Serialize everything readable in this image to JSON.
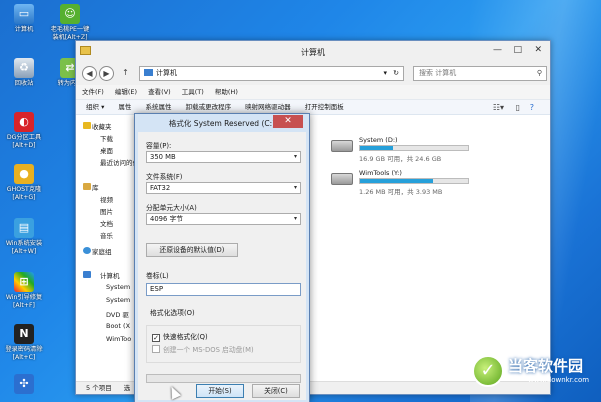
{
  "desktop": {
    "icons": [
      {
        "label": "计算机",
        "icon": "computer-icon"
      },
      {
        "label": "回收站",
        "icon": "recycle-bin-icon"
      },
      {
        "label": "DG分区工具\n[Alt+D]",
        "icon": "partition-tool-icon"
      },
      {
        "label": "GHOST克隆\n[Alt+G]",
        "icon": "ghost-icon"
      },
      {
        "label": "Win系统安装\n[Alt+W]",
        "icon": "win-install-icon"
      },
      {
        "label": "Win引导修复\n[Alt+F]",
        "icon": "boot-repair-icon"
      },
      {
        "label": "登录密码清除\n[Alt+C]",
        "icon": "password-clear-icon"
      },
      {
        "label": "老毛桃PE一键\n装机[Alt+Z]",
        "icon": "onekey-install-icon"
      },
      {
        "label": "转为内置",
        "icon": "convert-icon"
      }
    ],
    "watermark_text": "当客软件园",
    "watermark_url": "www.downkr.com"
  },
  "explorer": {
    "title": "计算机",
    "address": "计算机",
    "search_placeholder": "搜索 计算机",
    "menu": [
      "文件(F)",
      "编辑(E)",
      "查看(V)",
      "工具(T)",
      "帮助(H)"
    ],
    "toolbar": [
      "组织 ▾",
      "属性",
      "系统属性",
      "卸载或更改程序",
      "映射网络驱动器",
      "打开控制面板"
    ],
    "nav": {
      "favorites": "收藏夹",
      "fav_items": [
        "下载",
        "桌面",
        "最近访问的位置"
      ],
      "libraries": "库",
      "lib_items": [
        "视频",
        "图片",
        "文档",
        "音乐"
      ],
      "homegroup": "家庭组",
      "computer": "计算机",
      "computer_items": [
        "System",
        "System",
        "DVD 驱",
        "Boot (X",
        "WimToo"
      ]
    },
    "drives": [
      {
        "name": "System (D:)",
        "free_text": "16.9 GB 可用，共 24.6 GB",
        "used_fraction": 0.31
      },
      {
        "name": "WimTools (Y:)",
        "free_text": "1.26 MB 可用，共 3.93 MB",
        "used_fraction": 0.68
      }
    ],
    "status_left": "5 个项目",
    "status_right": "选"
  },
  "dialog": {
    "title": "格式化 System Reserved (C:)",
    "capacity_label": "容量(P):",
    "capacity_value": "350 MB",
    "fs_label": "文件系统(F)",
    "fs_value": "FAT32",
    "alloc_label": "分配单元大小(A)",
    "alloc_value": "4096 字节",
    "restore_button": "还原设备的默认值(D)",
    "volume_label": "卷标(L)",
    "volume_value": "ESP",
    "options_label": "格式化选项(O)",
    "quick_format": "快速格式化(Q)",
    "quick_format_checked": "✓",
    "msdos_disk": "创建一个 MS-DOS 启动盘(M)",
    "start_button": "开始(S)",
    "close_button": "关闭(C)",
    "close_x": "✕"
  }
}
